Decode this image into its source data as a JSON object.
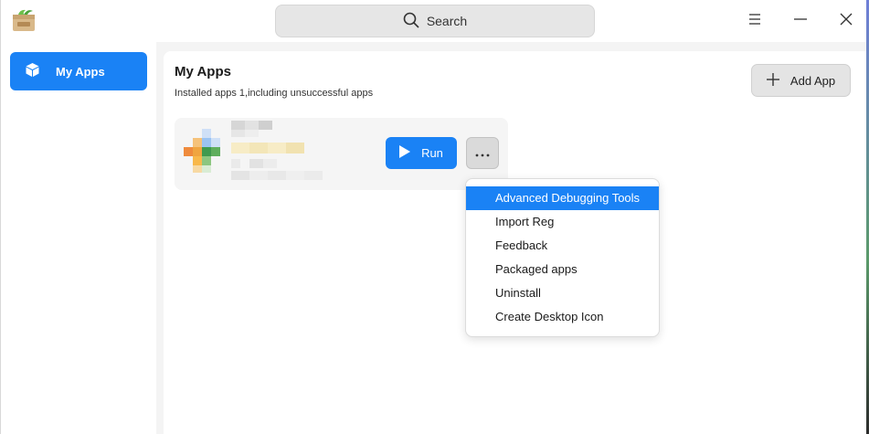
{
  "titlebar": {
    "search_label": "Search",
    "search_icon": "search-icon",
    "controls": [
      "menu-icon",
      "minimize-icon",
      "close-icon"
    ]
  },
  "sidebar": {
    "items": [
      {
        "label": "My Apps",
        "icon": "cube-icon",
        "active": true
      }
    ]
  },
  "main": {
    "title": "My Apps",
    "subtitle": "Installed apps 1,including unsuccessful apps",
    "add_app_label": "Add App",
    "apps": [
      {
        "run_label": "Run"
      }
    ]
  },
  "menu": {
    "items": [
      {
        "label": "Advanced Debugging Tools",
        "active": true
      },
      {
        "label": "Import Reg",
        "active": false
      },
      {
        "label": "Feedback",
        "active": false
      },
      {
        "label": "Packaged apps",
        "active": false
      },
      {
        "label": "Uninstall",
        "active": false
      },
      {
        "label": "Create Desktop Icon",
        "active": false
      }
    ]
  },
  "colors": {
    "accent": "#1a82f5",
    "background": "#f4f4f4",
    "panel": "#ffffff"
  }
}
